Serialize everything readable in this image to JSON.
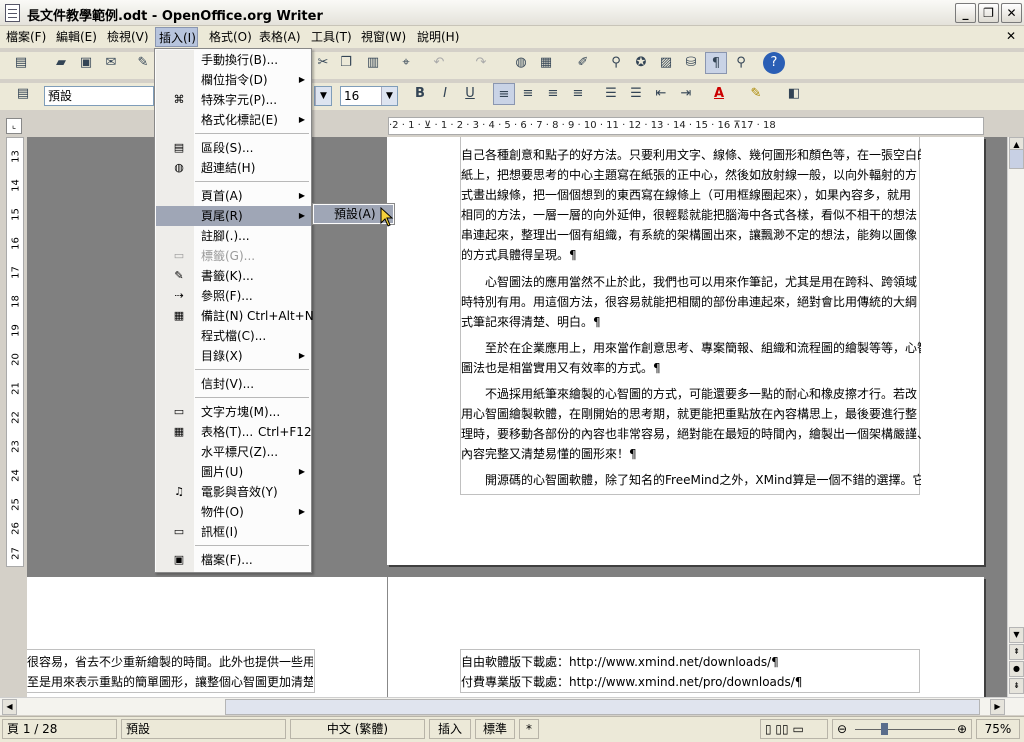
{
  "window": {
    "title": "長文件教學範例.odt - OpenOffice.org Writer",
    "minimize": "_",
    "maximize": "❐",
    "close": "✕"
  },
  "menubar": {
    "items": [
      "檔案(F)",
      "編輯(E)",
      "檢視(V)",
      "插入(I)",
      "格式(O)",
      "表格(A)",
      "工具(T)",
      "視窗(W)",
      "說明(H)"
    ],
    "doc_close": "✕"
  },
  "toolbar": {
    "style_value": "預設",
    "size_value": "16",
    "bold": "B",
    "italic": "I",
    "underline": "U"
  },
  "ruler": {
    "horizontal": "·2 · 1 · ⊻ · 1 · 2 · 3 · 4 · 5 · 6 · 7 · 8 · 9 · 10 · 11 · 12 · 13 · 14 · 15 · 16 ⊼17 · 18",
    "vertical": [
      "13",
      "14",
      "15",
      "16",
      "17",
      "18",
      "19",
      "20",
      "21",
      "22",
      "23",
      "24",
      "25",
      "26",
      "27"
    ]
  },
  "document": {
    "page1_lines": [
      "自己各種創意和點子的好方法。只要利用文字、線條、幾何圖形和顏色等，在一張空白的",
      "紙上，把想要思考的中心主題寫在紙張的正中心，然後如放射線一般，以向外輻射的方",
      "式畫出線條，把一個個想到的東西寫在線條上（可用框線圈起來），如果內容多，就用",
      "相同的方法，一層一層的向外延伸，很輕鬆就能把腦海中各式各樣，看似不相干的想法",
      "串連起來，整理出一個有組織，有系統的架構圖出來，讓飄渺不定的想法，能夠以圖像",
      "的方式具體得呈現。¶",
      "　　心智圖法的應用當然不止於此，我們也可以用來作筆記，尤其是用在跨科、跨領域",
      "時特別有用。用這個方法，很容易就能把相關的部份串連起來，絕對會比用傳統的大綱",
      "式筆記來得清楚、明白。¶",
      "　　至於在企業應用上，用來當作創意思考、專案簡報、組織和流程圖的繪製等等，心智",
      "圖法也是相當實用又有效率的方式。¶",
      "　　不過採用紙筆來繪製的心智圖的方式，可能還要多一點的耐心和橡皮擦才行。若改",
      "用心智圖繪製軟體，在剛開始的思考期，就更能把重點放在內容構思上，最後要進行整",
      "理時，要移動各部份的內容也非常容易，絕對能在最短的時間內，繪製出一個架構嚴謹、",
      "內容完整又清楚易懂的圖形來！¶",
      "　　開源碼的心智圖軟體，除了知名的FreeMind之外，XMind算是一個不錯的選擇。它"
    ],
    "page2_left": [
      "很容易，省去不少重新繪製的時間。此外也提供一些用",
      "至是用來表示重點的簡單圖形，讓整個心智圖更加清楚"
    ],
    "page2_right": [
      "自由軟體版下載處：http://www.xmind.net/downloads/¶",
      "付費專業版下載處：http://www.xmind.net/pro/downloads/¶"
    ]
  },
  "insert_menu": {
    "items": [
      {
        "label": "手動換行(B)...",
        "icon": "",
        "submenu": false
      },
      {
        "label": "欄位指令(D)",
        "icon": "",
        "submenu": true
      },
      {
        "label": "特殊字元(P)...",
        "icon": "⌘",
        "submenu": false
      },
      {
        "label": "格式化標記(E)",
        "icon": "",
        "submenu": true
      },
      {
        "label": "區段(S)...",
        "icon": "▤",
        "submenu": false
      },
      {
        "label": "超連結(H)",
        "icon": "◍",
        "submenu": false
      },
      {
        "label": "頁首(A)",
        "icon": "",
        "submenu": true
      },
      {
        "label": "頁尾(R)",
        "icon": "",
        "submenu": true
      },
      {
        "label": "註腳(.)...",
        "icon": "",
        "submenu": false
      },
      {
        "label": "標籤(G)...",
        "icon": "▭",
        "submenu": false
      },
      {
        "label": "書籤(K)...",
        "icon": "✎",
        "submenu": false
      },
      {
        "label": "參照(F)...",
        "icon": "⇢",
        "submenu": false
      },
      {
        "label": "備註(N)",
        "shortcut": "Ctrl+Alt+N",
        "icon": "▦",
        "submenu": false
      },
      {
        "label": "程式檔(C)...",
        "icon": "",
        "submenu": false
      },
      {
        "label": "目錄(X)",
        "icon": "",
        "submenu": true
      },
      {
        "label": "信封(V)...",
        "icon": "",
        "submenu": false
      },
      {
        "label": "文字方塊(M)...",
        "icon": "▭",
        "submenu": false
      },
      {
        "label": "表格(T)...",
        "shortcut": "Ctrl+F12",
        "icon": "▦",
        "submenu": false
      },
      {
        "label": "水平標尺(Z)...",
        "icon": "",
        "submenu": false
      },
      {
        "label": "圖片(U)",
        "icon": "",
        "submenu": true
      },
      {
        "label": "電影與音效(Y)",
        "icon": "♫",
        "submenu": false
      },
      {
        "label": "物件(O)",
        "icon": "",
        "submenu": true
      },
      {
        "label": "訊框(I)",
        "icon": "▭",
        "submenu": false
      },
      {
        "label": "檔案(F)...",
        "icon": "▣",
        "submenu": false
      }
    ]
  },
  "footer_submenu": {
    "item": "預設(A)"
  },
  "status": {
    "page": "頁 1 / 28",
    "style": "預設",
    "language": "中文 (繁體)",
    "insert_mode": "插入",
    "selection_mode": "標準",
    "modified": "*",
    "zoom": "75%"
  }
}
